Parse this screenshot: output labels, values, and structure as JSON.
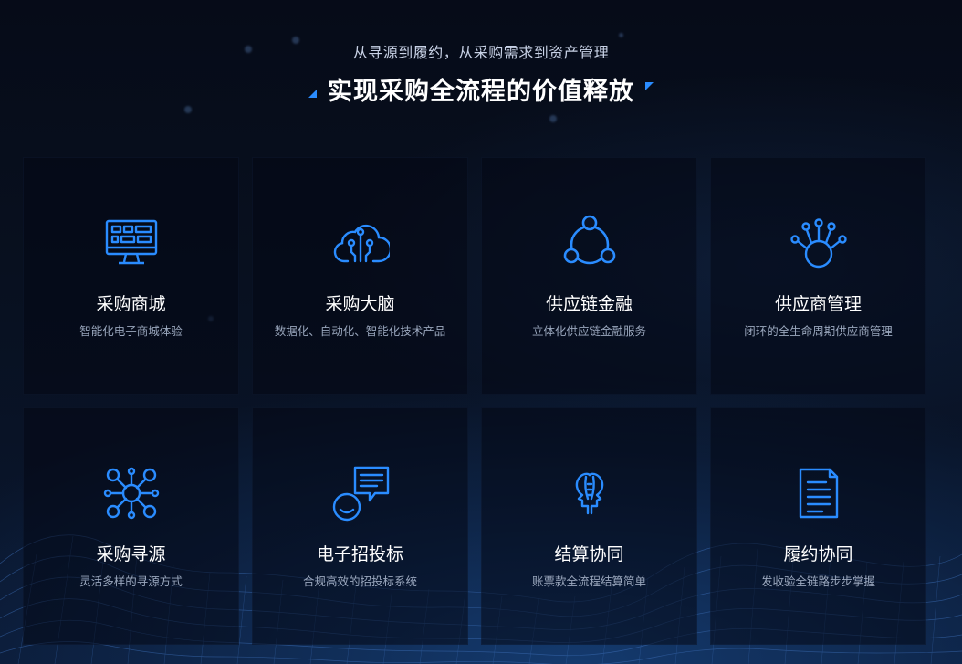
{
  "header": {
    "subtitle": "从寻源到履约，从采购需求到资产管理",
    "title": "实现采购全流程的价值释放"
  },
  "accent_color": "#2a8cff",
  "cards": [
    {
      "icon": "monitor-dashboard-icon",
      "title": "采购商城",
      "desc": "智能化电子商城体验"
    },
    {
      "icon": "cloud-network-icon",
      "title": "采购大脑",
      "desc": "数据化、自动化、智能化技术产品"
    },
    {
      "icon": "circular-nodes-icon",
      "title": "供应链金融",
      "desc": "立体化供应链金融服务"
    },
    {
      "icon": "hub-connections-icon",
      "title": "供应商管理",
      "desc": "闭环的全生命周期供应商管理"
    },
    {
      "icon": "network-nodes-icon",
      "title": "采购寻源",
      "desc": "灵活多样的寻源方式"
    },
    {
      "icon": "chat-user-icon",
      "title": "电子招投标",
      "desc": "合规高效的招投标系统"
    },
    {
      "icon": "two-heads-icon",
      "title": "结算协同",
      "desc": "账票款全流程结算简单"
    },
    {
      "icon": "document-icon",
      "title": "履约协同",
      "desc": "发收验全链路步步掌握"
    }
  ]
}
